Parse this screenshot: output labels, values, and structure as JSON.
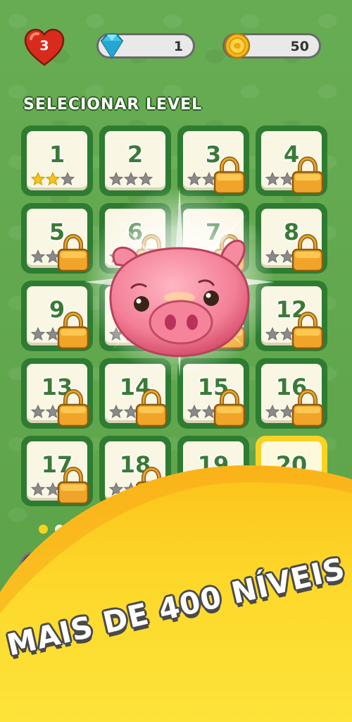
{
  "header": {
    "lives": "3",
    "gems": "1",
    "coins": "50"
  },
  "section_title": "SELECIONAR LEVEL",
  "levels": [
    {
      "number": "1",
      "stars": 2,
      "locked": false
    },
    {
      "number": "2",
      "stars": 0,
      "locked": false
    },
    {
      "number": "3",
      "stars": 0,
      "locked": true
    },
    {
      "number": "4",
      "stars": 0,
      "locked": true
    },
    {
      "number": "5",
      "stars": 0,
      "locked": true
    },
    {
      "number": "6",
      "stars": 0,
      "locked": true
    },
    {
      "number": "7",
      "stars": 0,
      "locked": true
    },
    {
      "number": "8",
      "stars": 0,
      "locked": true
    },
    {
      "number": "9",
      "stars": 0,
      "locked": true
    },
    {
      "number": "",
      "stars": 0,
      "locked": true
    },
    {
      "number": "",
      "stars": 0,
      "locked": true
    },
    {
      "number": "12",
      "stars": 0,
      "locked": true
    },
    {
      "number": "13",
      "stars": 0,
      "locked": true
    },
    {
      "number": "14",
      "stars": 0,
      "locked": true
    },
    {
      "number": "15",
      "stars": 0,
      "locked": true
    },
    {
      "number": "16",
      "stars": 0,
      "locked": true
    },
    {
      "number": "17",
      "stars": 0,
      "locked": true
    },
    {
      "number": "18",
      "stars": 0,
      "locked": true
    },
    {
      "number": "19",
      "stars": 0,
      "locked": true
    },
    {
      "number": "20",
      "stars": 0,
      "locked": false
    }
  ],
  "promo": "MAIS DE 400 NÍVEIS",
  "colors": {
    "background": "#5fa84a",
    "tile_border": "#2d7c31",
    "banner": "#fcd72a",
    "star_filled": "#f5c518",
    "star_empty": "#8a8a8a"
  },
  "icons": [
    "heart-icon",
    "diamond-icon",
    "coin-icon",
    "star-icon",
    "lock-icon",
    "pig-mascot"
  ]
}
